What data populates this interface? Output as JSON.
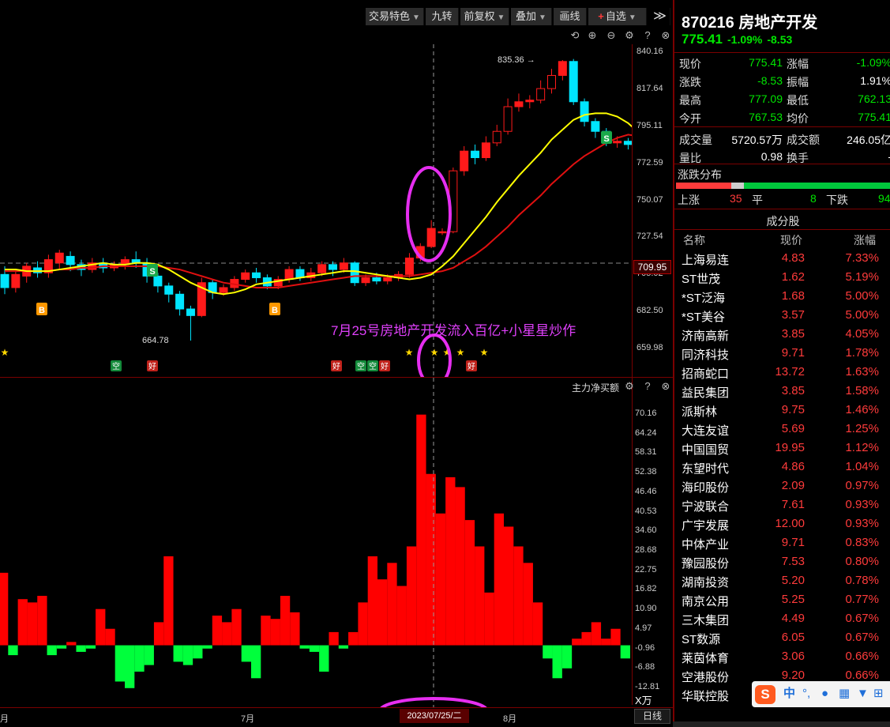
{
  "toolbar": {
    "buttons": [
      {
        "label": "交易特色",
        "caret": true
      },
      {
        "label": "九转",
        "caret": false
      },
      {
        "label": "前复权",
        "caret": true
      },
      {
        "label": "叠加",
        "caret": true
      },
      {
        "label": "画线",
        "caret": false
      },
      {
        "label": "自选",
        "caret": true
      }
    ],
    "add_symbol": "+",
    "more": "≫"
  },
  "chart_icons": [
    "refresh-icon",
    "zoom-in-icon",
    "zoom-out-icon",
    "settings-icon",
    "help-icon",
    "close-icon"
  ],
  "kline": {
    "price_ticks": [
      "840.16",
      "817.64",
      "795.11",
      "772.59",
      "750.07",
      "727.54",
      "705.02",
      "682.50",
      "659.98"
    ],
    "current_price_tag": "709.95",
    "high_label": "835.36",
    "low_label": "664.78",
    "annotation": "7月25号房地产开发流入百亿+小星星炒作",
    "signal_badges": {
      "buy": "B",
      "sell": "S"
    },
    "marker_labels": {
      "empty": "空",
      "good": "好"
    }
  },
  "indicator": {
    "name": "主力净买额",
    "ticks": [
      "70.16",
      "64.24",
      "58.31",
      "52.38",
      "46.46",
      "40.53",
      "34.60",
      "28.68",
      "22.75",
      "16.82",
      "10.90",
      "4.97",
      "-0.96",
      "-6.88",
      "-12.81"
    ],
    "unit": "X万"
  },
  "date_axis": {
    "labels": [
      "月",
      "7月",
      "8月"
    ],
    "crosshair_date": "2023/07/25/二",
    "period": "日线"
  },
  "stock": {
    "code": "870216",
    "name": "房地产开发",
    "price": "775.41",
    "change_pct": "-1.09%",
    "change": "-8.53"
  },
  "quote_rows": [
    {
      "l1": "现价",
      "v1": "775.41",
      "c1": "green",
      "l2": "涨幅",
      "v2": "-1.09%",
      "c2": "green"
    },
    {
      "l1": "涨跌",
      "v1": "-8.53",
      "c1": "green",
      "l2": "振幅",
      "v2": "1.91%",
      "c2": "white"
    },
    {
      "l1": "最高",
      "v1": "777.09",
      "c1": "green",
      "l2": "最低",
      "v2": "762.13",
      "c2": "green"
    },
    {
      "l1": "今开",
      "v1": "767.53",
      "c1": "green",
      "l2": "均价",
      "v2": "775.41",
      "c2": "green"
    },
    {
      "l1": "成交量",
      "v1": "5720.57万",
      "c1": "white",
      "l2": "成交额",
      "v2": "246.05亿",
      "c2": "white"
    },
    {
      "l1": "量比",
      "v1": "0.98",
      "c1": "white",
      "l2": "换手",
      "v2": "-",
      "c2": "white"
    }
  ],
  "distribution": {
    "title": "涨跌分布",
    "up_label": "上涨",
    "up": "35",
    "flat_label": "平",
    "flat": "8",
    "down_label": "下跌",
    "down": "94",
    "colors": {
      "up": "#ff3b3b",
      "flat": "#cccccc",
      "down": "#00c83c"
    }
  },
  "components": {
    "title": "成分股",
    "headers": [
      "名称",
      "现价",
      "涨幅"
    ],
    "rows": [
      {
        "name": "上海易连",
        "price": "4.83",
        "chg": "7.33%",
        "cyan": false
      },
      {
        "name": "ST世茂",
        "price": "1.62",
        "chg": "5.19%",
        "cyan": false
      },
      {
        "name": "*ST泛海",
        "price": "1.68",
        "chg": "5.00%",
        "cyan": true
      },
      {
        "name": "*ST美谷",
        "price": "3.57",
        "chg": "5.00%",
        "cyan": true
      },
      {
        "name": "济南高新",
        "price": "3.85",
        "chg": "4.05%",
        "cyan": false
      },
      {
        "name": "同济科技",
        "price": "9.71",
        "chg": "1.78%",
        "cyan": false
      },
      {
        "name": "招商蛇口",
        "price": "13.72",
        "chg": "1.63%",
        "cyan": false
      },
      {
        "name": "益民集团",
        "price": "3.85",
        "chg": "1.58%",
        "cyan": false
      },
      {
        "name": "派斯林",
        "price": "9.75",
        "chg": "1.46%",
        "cyan": false
      },
      {
        "name": "大连友谊",
        "price": "5.69",
        "chg": "1.25%",
        "cyan": false
      },
      {
        "name": "中国国贸",
        "price": "19.95",
        "chg": "1.12%",
        "cyan": false
      },
      {
        "name": "东望时代",
        "price": "4.86",
        "chg": "1.04%",
        "cyan": false
      },
      {
        "name": "海印股份",
        "price": "2.09",
        "chg": "0.97%",
        "cyan": false
      },
      {
        "name": "宁波联合",
        "price": "7.61",
        "chg": "0.93%",
        "cyan": false
      },
      {
        "name": "广宇发展",
        "price": "12.00",
        "chg": "0.93%",
        "cyan": true
      },
      {
        "name": "中体产业",
        "price": "9.71",
        "chg": "0.83%",
        "cyan": false
      },
      {
        "name": "豫园股份",
        "price": "7.53",
        "chg": "0.80%",
        "cyan": false
      },
      {
        "name": "湖南投资",
        "price": "5.20",
        "chg": "0.78%",
        "cyan": false
      },
      {
        "name": "南京公用",
        "price": "5.25",
        "chg": "0.77%",
        "cyan": false
      },
      {
        "name": "三木集团",
        "price": "4.49",
        "chg": "0.67%",
        "cyan": false
      },
      {
        "name": "ST数源",
        "price": "6.05",
        "chg": "0.67%",
        "cyan": false
      },
      {
        "name": "莱茵体育",
        "price": "3.06",
        "chg": "0.66%",
        "cyan": false
      },
      {
        "name": "空港股份",
        "price": "9.20",
        "chg": "0.66%",
        "cyan": false
      },
      {
        "name": "华联控股",
        "price": "",
        "chg": "",
        "cyan": false
      }
    ]
  },
  "ime": {
    "logo": "S",
    "mode": "中",
    "punct": "°,",
    "icons": [
      "mic-icon",
      "keyboard-icon",
      "shirt-icon",
      "grid-icon"
    ]
  },
  "colors": {
    "up": "#ff1a1a",
    "down": "#00e5ff",
    "ma5": "#ffff00",
    "ma10": "#e01010",
    "flow_pos": "#ff0000",
    "flow_neg": "#00ff3c",
    "highlight": "#e62ef0"
  },
  "chart_data": {
    "type": "candlestick",
    "price_range": [
      659.98,
      840.16
    ],
    "candles": [
      [
        705,
        697,
        710,
        693
      ],
      [
        697,
        705,
        708,
        694
      ],
      [
        704,
        710,
        712,
        700
      ],
      [
        709,
        706,
        713,
        703
      ],
      [
        706,
        714,
        717,
        703
      ],
      [
        712,
        718,
        720,
        708
      ],
      [
        716,
        711,
        719,
        707
      ],
      [
        711,
        708,
        714,
        704
      ],
      [
        708,
        712,
        715,
        706
      ],
      [
        712,
        709,
        715,
        706
      ],
      [
        709,
        711,
        713,
        707
      ],
      [
        711,
        714,
        716,
        708
      ],
      [
        714,
        712,
        719,
        709
      ],
      [
        712,
        704,
        715,
        700
      ],
      [
        704,
        698,
        706,
        694
      ],
      [
        698,
        693,
        700,
        688
      ],
      [
        693,
        684,
        695,
        680
      ],
      [
        684,
        680,
        686,
        664.78
      ],
      [
        680,
        700,
        703,
        679
      ],
      [
        700,
        694,
        702,
        690
      ],
      [
        694,
        697,
        699,
        692
      ],
      [
        697,
        702,
        704,
        695
      ],
      [
        702,
        706,
        708,
        700
      ],
      [
        706,
        703,
        709,
        700
      ],
      [
        703,
        698,
        705,
        696
      ],
      [
        698,
        702,
        704,
        696
      ],
      [
        702,
        708,
        710,
        700
      ],
      [
        708,
        703,
        710,
        701
      ],
      [
        703,
        706,
        709,
        701
      ],
      [
        706,
        711,
        713,
        704
      ],
      [
        711,
        708,
        713,
        704
      ],
      [
        708,
        712,
        715,
        706
      ],
      [
        712,
        700,
        713,
        698
      ],
      [
        700,
        703,
        705,
        698
      ],
      [
        703,
        701,
        706,
        699
      ],
      [
        701,
        703,
        705,
        699
      ],
      [
        703,
        705,
        707,
        701
      ],
      [
        705,
        715,
        718,
        703
      ],
      [
        715,
        722,
        724,
        713
      ],
      [
        722,
        733,
        738,
        721
      ],
      [
        731,
        731,
        733,
        729
      ],
      [
        731,
        768,
        770,
        730
      ],
      [
        768,
        780,
        783,
        765
      ],
      [
        780,
        776,
        784,
        772
      ],
      [
        776,
        785,
        789,
        774
      ],
      [
        785,
        792,
        796,
        783
      ],
      [
        792,
        807,
        812,
        790
      ],
      [
        807,
        810,
        815,
        804
      ],
      [
        810,
        811,
        814,
        806
      ],
      [
        811,
        818,
        823,
        809
      ],
      [
        818,
        826,
        830,
        815
      ],
      [
        826,
        834.5,
        835.36,
        823
      ],
      [
        834.5,
        810,
        836,
        808
      ],
      [
        810,
        798,
        812,
        795
      ],
      [
        798,
        792,
        800,
        788
      ],
      [
        792,
        785,
        794,
        783
      ],
      [
        785,
        786,
        789,
        782
      ],
      [
        786,
        784,
        788,
        781
      ],
      [
        784,
        775.41,
        793,
        774
      ]
    ],
    "ma5": [
      708,
      708,
      707,
      707,
      707,
      708,
      709,
      710,
      711,
      712,
      711,
      711,
      712,
      712,
      711,
      708,
      704,
      700,
      697,
      694,
      693,
      694,
      696,
      699,
      700,
      701,
      702,
      703,
      704,
      705,
      706,
      707,
      707,
      706,
      705,
      704,
      703,
      702,
      703,
      705,
      710,
      716,
      724,
      732,
      740,
      749,
      757,
      765,
      772,
      779,
      787,
      793,
      799,
      802,
      803,
      803,
      801,
      797,
      791
    ],
    "ma10": [
      707,
      707,
      707,
      707,
      707,
      708,
      708,
      709,
      709,
      710,
      710,
      710,
      710,
      710,
      710,
      709,
      708,
      706,
      704,
      702,
      700,
      699,
      698,
      697,
      697,
      697,
      698,
      699,
      700,
      701,
      702,
      703,
      704,
      704,
      704,
      704,
      704,
      704,
      705,
      706,
      707,
      709,
      713,
      717,
      722,
      728,
      734,
      741,
      747,
      753,
      760,
      766,
      772,
      777,
      781,
      785,
      788,
      790,
      789
    ]
  },
  "flow_data": {
    "type": "bar",
    "range": [
      -12.81,
      70.16
    ],
    "values": [
      22,
      -3,
      14,
      13,
      15,
      -3,
      -1,
      1,
      -2,
      -1,
      11,
      5,
      -11,
      -13,
      -8,
      -6,
      7,
      27,
      -5,
      -6,
      -4,
      -1,
      9,
      7,
      11,
      -5,
      -10,
      9,
      8,
      15,
      10,
      -1,
      -2,
      -8,
      4,
      -1,
      4,
      13,
      27,
      20,
      25,
      18,
      30,
      70,
      52,
      40,
      51,
      48,
      38,
      30,
      16,
      40,
      36,
      30,
      25,
      13,
      -4,
      -10,
      -7,
      2,
      4,
      7,
      2,
      5,
      -4
    ]
  }
}
